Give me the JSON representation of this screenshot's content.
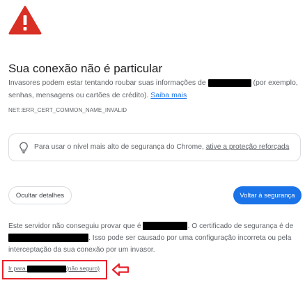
{
  "header": {
    "icon": "warning-triangle-icon",
    "icon_color": "#d93025",
    "title": "Sua conexão não é particular"
  },
  "description": {
    "part1": "Invasores podem estar tentando roubar suas informações de ",
    "part2": " (por exemplo, senhas, mensagens ou cartões de crédito). ",
    "learn_more": "Saiba mais"
  },
  "error_code": "NET::ERR_CERT_COMMON_NAME_INVALID",
  "enhanced_protection": {
    "icon": "lightbulb-icon",
    "text": "Para usar o nível mais alto de segurança do Chrome, ",
    "link": "ative a proteção reforçada"
  },
  "buttons": {
    "hide_details": "Ocultar detalhes",
    "back_to_safety": "Voltar à segurança"
  },
  "details": {
    "part1": "Este servidor não conseguiu provar que é ",
    "part2": ". O certificado de segurança é de ",
    "part3": ". Isso pode ser causado por uma configuração incorreta ou pela interceptação da sua conexão por um invasor."
  },
  "proceed": {
    "prefix": "Ir para ",
    "suffix": "(não seguro)"
  },
  "annotation": {
    "icon": "left-arrow-icon",
    "color": "#e8202a"
  },
  "colors": {
    "accent": "#1a73e8",
    "warning": "#d93025",
    "annotation": "#e8202a"
  }
}
